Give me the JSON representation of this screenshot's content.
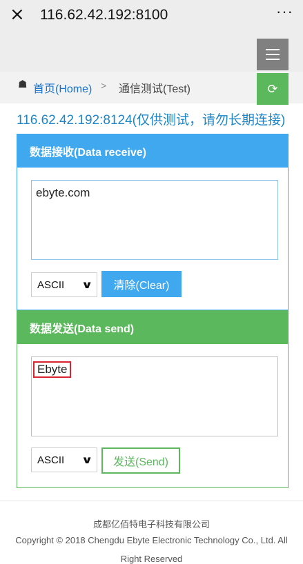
{
  "browser": {
    "close_icon": "×",
    "url": "116.62.42.192:8100",
    "more_icon": "···"
  },
  "header": {
    "menu_icon": "hamburger-icon"
  },
  "breadcrumb": {
    "home_icon": "☗",
    "home_label": "首页(Home)",
    "separator": ">",
    "current_label": "通信测试(Test)",
    "refresh_icon": "⟳"
  },
  "connection": {
    "address_text": "116.62.42.192:8124(仅供测试，请勿长期连接)"
  },
  "receive_panel": {
    "title": "数据接收(Data receive)",
    "content": "ebyte.com",
    "encoding_selected": "ASCII",
    "clear_label": "清除(Clear)"
  },
  "send_panel": {
    "title": "数据发送(Data send)",
    "content": "Ebyte",
    "encoding_selected": "ASCII",
    "send_label": "发送(Send)"
  },
  "footer": {
    "company": "成都亿佰特电子科技有限公司",
    "copyright": "Copyright © 2018 Chengdu Ebyte Electronic Technology Co., Ltd. All",
    "rights": "Right Reserved"
  },
  "colors": {
    "blue_accent": "#3fa8ef",
    "green_accent": "#5cb85c",
    "highlight_red": "#d9232e"
  }
}
